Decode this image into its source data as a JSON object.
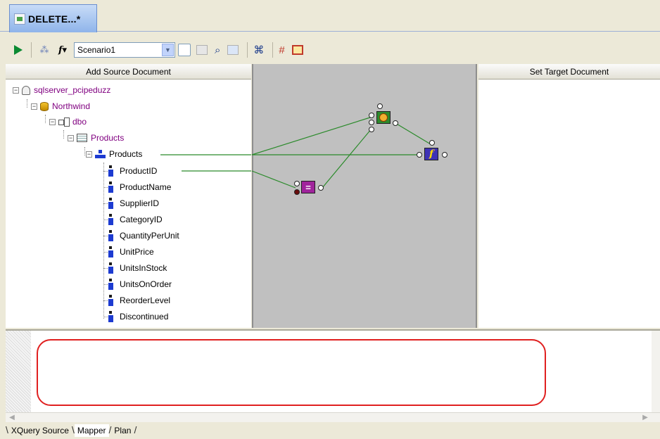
{
  "document_tab": {
    "label": "DELETE...*"
  },
  "toolbar": {
    "scenario_value": "Scenario1"
  },
  "panes": {
    "source_header": "Add Source Document",
    "target_header": "Set Target Document"
  },
  "tree": {
    "server": "sqlserver_pcipeduzz",
    "database": "Northwind",
    "schema": "dbo",
    "table": "Products",
    "element": "Products",
    "fields": [
      "ProductID",
      "ProductName",
      "SupplierID",
      "CategoryID",
      "QuantityPerUnit",
      "UnitPrice",
      "UnitsInStock",
      "UnitsOnOrder",
      "ReorderLevel",
      "Discontinued"
    ]
  },
  "mapper_nodes": {
    "equals_symbol": "=",
    "function_symbol": "f"
  },
  "bottom_tabs": [
    "XQuery Source",
    "Mapper",
    "Plan"
  ],
  "colors": {
    "wire": "#2a8a2a",
    "highlight_oval": "#e02020",
    "mapper_bg": "#c0c0c0"
  }
}
